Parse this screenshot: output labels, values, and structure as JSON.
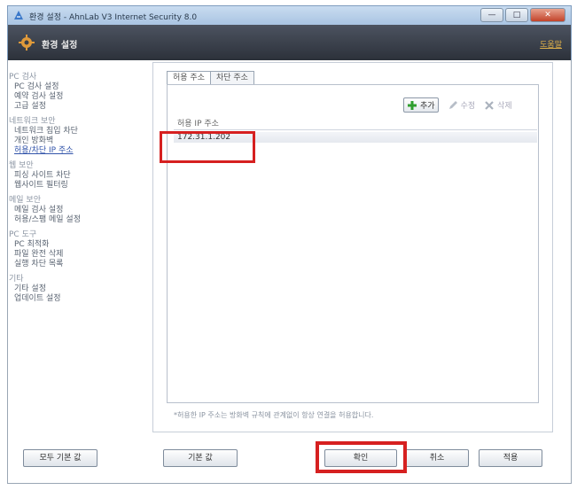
{
  "window": {
    "title": "환경 설정 - AhnLab V3 Internet Security 8.0",
    "buttons": {
      "minimize": "—",
      "maximize": "□",
      "close": "✕"
    }
  },
  "header": {
    "title": "환경 설정",
    "help": "도움말"
  },
  "sidebar": {
    "sections": [
      {
        "category": "PC 검사",
        "items": [
          "PC 검사 설정",
          "예약 검사 설정",
          "고급 설정"
        ]
      },
      {
        "category": "네트워크 보안",
        "items": [
          "네트워크 침입 차단",
          "개인 방화벽",
          "허용/차단 IP 주소"
        ],
        "active_index": 2
      },
      {
        "category": "웹 보안",
        "items": [
          "피싱 사이트 차단",
          "웹사이트 필터링"
        ]
      },
      {
        "category": "메일 보안",
        "items": [
          "메일 검사 설정",
          "허용/스팸 메일 설정"
        ]
      },
      {
        "category": "PC 도구",
        "items": [
          "PC 최적화",
          "파일 완전 삭제",
          "실행 차단 목록"
        ]
      },
      {
        "category": "기타",
        "items": [
          "기타 설정",
          "업데이트 설정"
        ]
      }
    ]
  },
  "tabs": [
    {
      "label": "허용 주소",
      "active": true
    },
    {
      "label": "차단 주소",
      "active": false
    }
  ],
  "toolbar": {
    "add": "추가",
    "edit": "수정",
    "delete": "삭제"
  },
  "list": {
    "column_header": "허용 IP 주소",
    "rows": [
      "172.31.1.202"
    ]
  },
  "note": "*허용한 IP 주소는 방화벽 규칙에 관계없이 항상 연결을 허용합니다.",
  "buttons": {
    "all_defaults": "모두 기본 값",
    "defaults": "기본 값",
    "ok": "확인",
    "cancel": "취소",
    "apply": "적용"
  },
  "colors": {
    "highlight": "#d62020",
    "add_icon": "#2e9e2e"
  }
}
